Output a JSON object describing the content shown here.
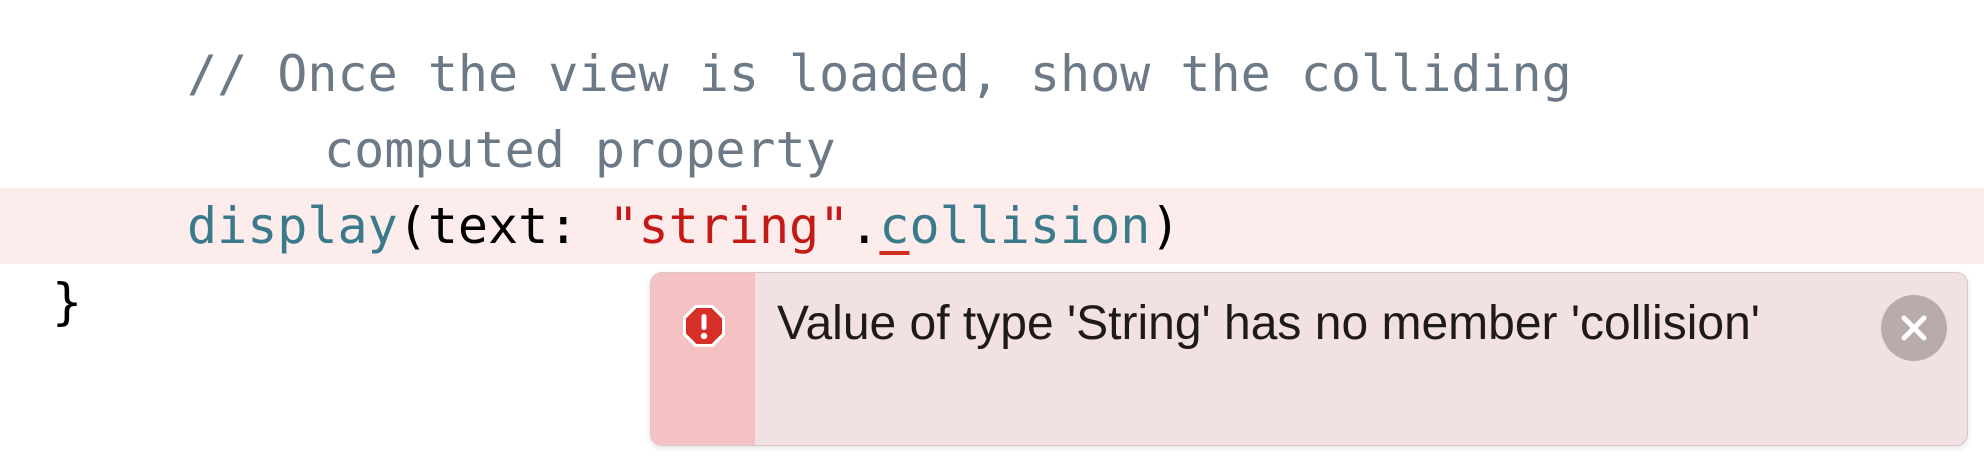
{
  "code": {
    "comment_line_1": "// Once the view is loaded, show the colliding",
    "comment_line_2": "computed property",
    "call_function": "display",
    "call_open": "(text: ",
    "call_string": "\"string\"",
    "call_dot": ".",
    "call_member_error_char": "c",
    "call_member_rest": "ollision",
    "call_close": ")",
    "closing_brace": "}"
  },
  "error": {
    "message": "Value of type 'String' has no member 'collision'",
    "icon": "error-octagon-icon",
    "close_icon": "close-icon"
  },
  "colors": {
    "error_line_background": "#fdecec",
    "error_popup_background": "#f1e1e2",
    "error_gutter": "#f4c2c2",
    "error_icon": "#d62f27",
    "comment": "#6c7986",
    "string": "#c41a16",
    "identifier": "#3b7a8a"
  }
}
